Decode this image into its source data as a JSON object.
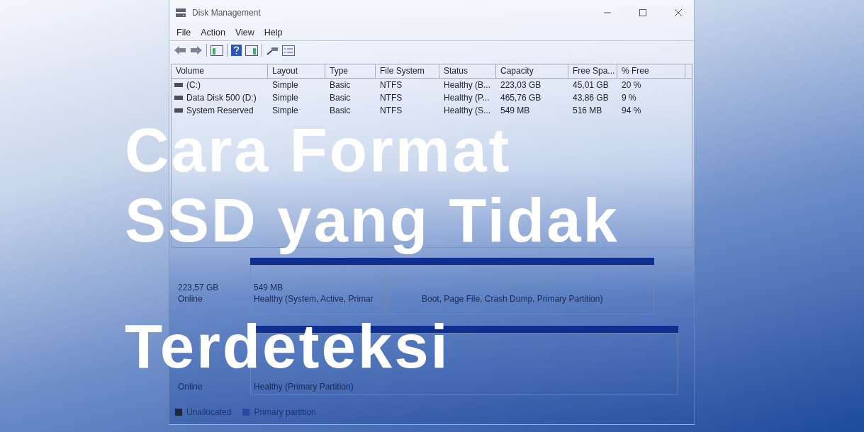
{
  "window": {
    "title": "Disk Management"
  },
  "menu": [
    "File",
    "Action",
    "View",
    "Help"
  ],
  "volumes": {
    "columns": [
      "Volume",
      "Layout",
      "Type",
      "File System",
      "Status",
      "Capacity",
      "Free Spa...",
      "% Free"
    ],
    "rows": [
      {
        "cells": [
          "(C:)",
          "Simple",
          "Basic",
          "NTFS",
          "Healthy (B...",
          "223,03 GB",
          "45,01 GB",
          "20 %"
        ]
      },
      {
        "cells": [
          "Data Disk 500 (D:)",
          "Simple",
          "Basic",
          "NTFS",
          "Healthy (P...",
          "465,76 GB",
          "43,86 GB",
          "9 %"
        ]
      },
      {
        "cells": [
          "System Reserved",
          "Simple",
          "Basic",
          "NTFS",
          "Healthy (S...",
          "549 MB",
          "516 MB",
          "94 %"
        ]
      }
    ]
  },
  "disks": [
    {
      "info": [
        "223,57 GB",
        "Online"
      ],
      "partitions": [
        {
          "lines": [
            "549 MB",
            "Healthy (System, Active, Primar"
          ]
        },
        {
          "lines": [
            "Boot, Page File, Crash Dump, Primary Partition)"
          ]
        }
      ]
    },
    {
      "info": [
        "Online"
      ],
      "partitions": [
        {
          "lines": [
            "Healthy (Primary Partition)"
          ]
        }
      ]
    }
  ],
  "legend": [
    {
      "label": "Unallocated",
      "color": "#1c2740"
    },
    {
      "label": "Primary partition",
      "color": "#2a4aa8"
    }
  ],
  "headline": [
    "Cara Format",
    "SSD yang Tidak",
    "Terdeteksi"
  ]
}
